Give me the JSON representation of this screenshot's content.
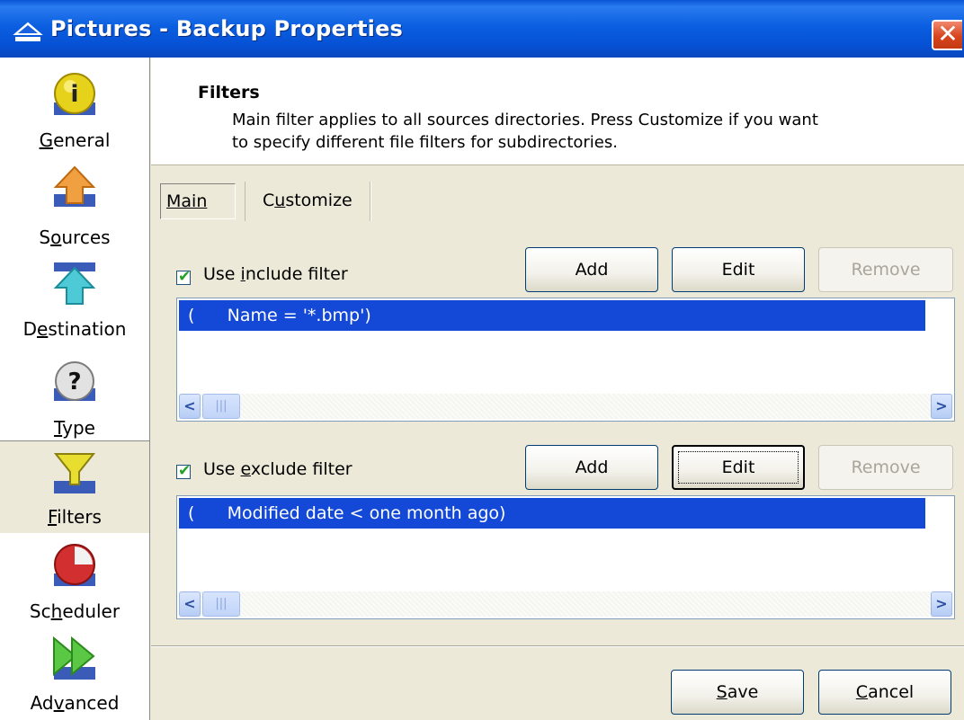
{
  "window": {
    "title": "Pictures - Backup Properties",
    "close_label": "✕"
  },
  "sidebar": {
    "items": [
      {
        "label_pre": "",
        "label_ul": "G",
        "label_post": "eneral",
        "icon": "info-icon"
      },
      {
        "label_pre": "S",
        "label_ul": "o",
        "label_post": "urces",
        "icon": "up-arrow-icon"
      },
      {
        "label_pre": "D",
        "label_ul": "e",
        "label_post": "stination",
        "icon": "down-arrow-icon"
      },
      {
        "label_pre": "",
        "label_ul": "T",
        "label_post": "ype",
        "icon": "question-icon"
      },
      {
        "label_pre": "",
        "label_ul": "F",
        "label_post": "ilters",
        "icon": "funnel-icon"
      },
      {
        "label_pre": "Sc",
        "label_ul": "h",
        "label_post": "eduler",
        "icon": "clock-icon"
      },
      {
        "label_pre": "Ad",
        "label_ul": "v",
        "label_post": "anced",
        "icon": "fast-forward-icon"
      }
    ],
    "active_index": 4
  },
  "header": {
    "title": "Filters",
    "line1": "Main filter applies to all sources directories. Press Customize if you want",
    "line2": "to specify different file filters for subdirectories."
  },
  "tabs": {
    "main_label": "Main",
    "customize_pre": "C",
    "customize_ul": "u",
    "customize_post": "stomize"
  },
  "include": {
    "checkbox_pre": "Use ",
    "checkbox_ul": "i",
    "checkbox_post": "nclude filter",
    "checked": true,
    "add_label": "Add",
    "edit_label": "Edit",
    "remove_label": "Remove",
    "items": [
      "(      Name = '*.bmp')"
    ]
  },
  "exclude": {
    "checkbox_pre": "Use ",
    "checkbox_ul": "e",
    "checkbox_post": "xclude filter",
    "checked": true,
    "add_label": "Add",
    "edit_label": "Edit",
    "remove_label": "Remove",
    "items": [
      "(      Modified date < one month ago)"
    ]
  },
  "footer": {
    "save_ul": "S",
    "save_post": "ave",
    "cancel_ul": "C",
    "cancel_post": "ancel"
  }
}
